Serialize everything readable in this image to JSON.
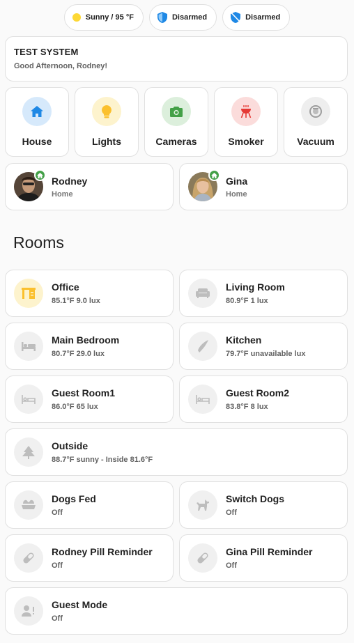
{
  "chips": {
    "weather": "Sunny / 95 °F",
    "alarm1": "Disarmed",
    "alarm2": "Disarmed"
  },
  "welcome": {
    "title": "TEST SYSTEM",
    "greeting": "Good Afternoon, Rodney!"
  },
  "tiles": [
    {
      "label": "House",
      "icon": "home-icon",
      "color": "#1e88e5",
      "bg": "#d6e9fb"
    },
    {
      "label": "Lights",
      "icon": "lightbulb-icon",
      "color": "#fbc02d",
      "bg": "#fdf3cd"
    },
    {
      "label": "Cameras",
      "icon": "camera-icon",
      "color": "#43a047",
      "bg": "#dcefdc"
    },
    {
      "label": "Smoker",
      "icon": "grill-icon",
      "color": "#e53935",
      "bg": "#fbdcdb"
    },
    {
      "label": "Vacuum",
      "icon": "robot-vacuum-icon",
      "color": "#9e9e9e",
      "bg": "#eeeeee"
    }
  ],
  "people": [
    {
      "name": "Rodney",
      "state": "Home"
    },
    {
      "name": "Gina",
      "state": "Home"
    }
  ],
  "rooms_title": "Rooms",
  "rooms": [
    {
      "name": "Office",
      "state": "85.1°F 9.0 lux",
      "icon": "desk-icon",
      "active": true
    },
    {
      "name": "Living Room",
      "state": "80.9°F 1 lux",
      "icon": "sofa-icon"
    },
    {
      "name": "Main Bedroom",
      "state": "80.7°F 29.0 lux",
      "icon": "bed-icon"
    },
    {
      "name": "Kitchen",
      "state": "79.7°F unavailable lux",
      "icon": "knife-icon"
    },
    {
      "name": "Guest Room1",
      "state": "86.0°F 65 lux",
      "icon": "bed-outline-icon"
    },
    {
      "name": "Guest Room2",
      "state": "83.8°F 8 lux",
      "icon": "bed-outline-icon"
    },
    {
      "name": "Outside",
      "state": "88.7°F sunny - Inside 81.6°F",
      "icon": "pine-tree-icon"
    },
    {
      "name": "Dogs Fed",
      "state": "Off",
      "icon": "dog-bowl-icon"
    },
    {
      "name": "Switch Dogs",
      "state": "Off",
      "icon": "dog-icon"
    },
    {
      "name": "Rodney Pill Reminder",
      "state": "Off",
      "icon": "pill-icon"
    },
    {
      "name": "Gina Pill Reminder",
      "state": "Off",
      "icon": "pill-icon"
    },
    {
      "name": "Guest Mode",
      "state": "Off",
      "icon": "account-alert-icon"
    }
  ]
}
